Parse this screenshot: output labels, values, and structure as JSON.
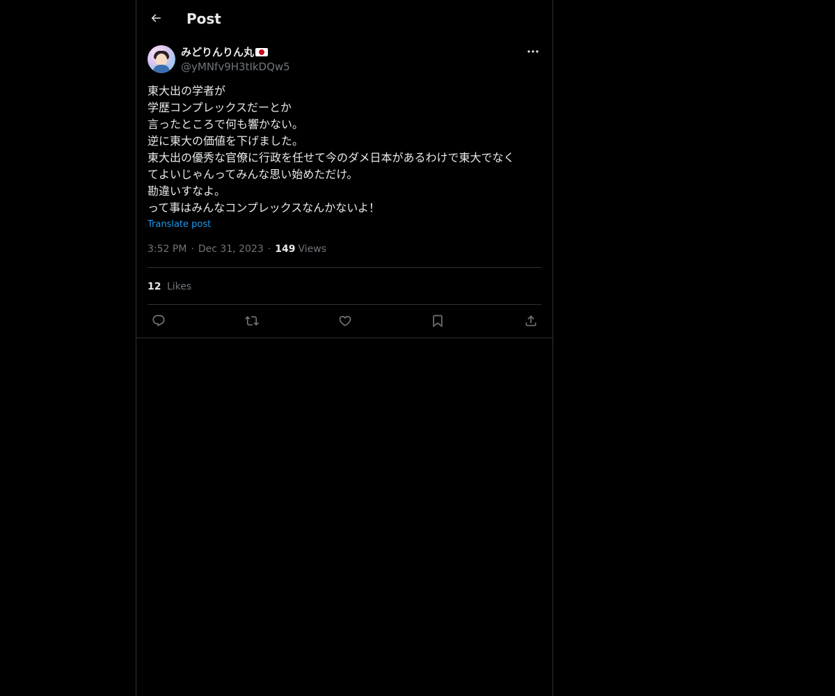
{
  "header": {
    "title": "Post",
    "back_icon": "arrow-left-icon"
  },
  "author": {
    "display_name": "みどりんりん丸",
    "flag_icon": "japan-flag-icon",
    "handle": "@yMNfv9H3tIkDQw5"
  },
  "post": {
    "text": "東大出の学者が\n学歴コンプレックスだーとか\n言ったところで何も響かない。\n逆に東大の価値を下げました。\n東大出の優秀な官僚に行政を任せて今のダメ日本があるわけで東大でなく\nてよいじゃんってみんな思い始めただけ。\n勘違いすなよ。\nって事はみんなコンプレックスなんかないよ！",
    "translate_label": "Translate post",
    "time": "3:52 PM",
    "date": "Dec 31, 2023",
    "views_count": "149",
    "views_label": "Views",
    "likes_count": "12",
    "likes_label": "Likes"
  },
  "actions": [
    {
      "name": "reply",
      "icon": "reply-icon"
    },
    {
      "name": "repost",
      "icon": "repost-icon"
    },
    {
      "name": "like",
      "icon": "heart-icon"
    },
    {
      "name": "bookmark",
      "icon": "bookmark-icon"
    },
    {
      "name": "share",
      "icon": "share-icon"
    }
  ],
  "colors": {
    "background": "#000000",
    "text": "#e7e9ea",
    "muted": "#71767b",
    "border": "#2f3336",
    "link": "#1d9bf0"
  }
}
